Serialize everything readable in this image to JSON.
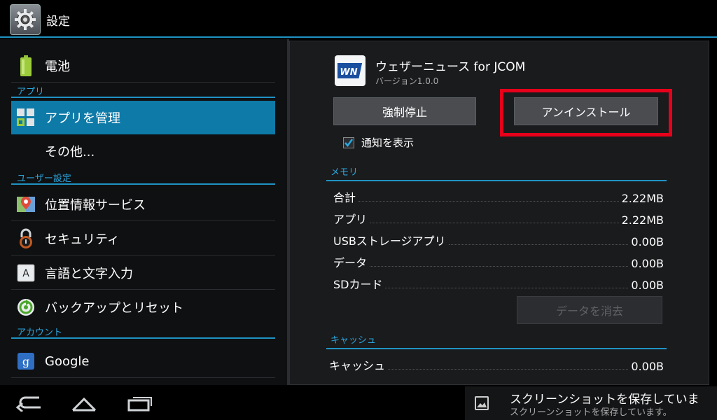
{
  "actionbar": {
    "title": "設定",
    "icon": "gear-icon"
  },
  "sidebar": {
    "items": [
      {
        "label": "電池",
        "icon": "battery-icon"
      },
      {
        "label": "アプリを管理",
        "icon": "apps-grid-icon",
        "selected": true
      },
      {
        "label": "その他...",
        "icon": ""
      },
      {
        "label": "位置情報サービス",
        "icon": "location-map-icon"
      },
      {
        "label": "セキュリティ",
        "icon": "lock-icon"
      },
      {
        "label": "言語と文字入力",
        "icon": "keyboard-a-icon"
      },
      {
        "label": "バックアップとリセット",
        "icon": "backup-reset-icon"
      },
      {
        "label": "Google",
        "icon": "google-icon"
      }
    ],
    "sections": [
      "アプリ",
      "ユーザー設定",
      "アカウント"
    ]
  },
  "detail": {
    "app_name": "ウェザーニュース for JCOM",
    "version": "バージョン1.0.0",
    "force_stop_label": "強制停止",
    "uninstall_label": "アンインストール",
    "notify_label": "通知を表示",
    "notify_checked": true,
    "memory_header": "メモリ",
    "memory_rows": [
      {
        "key": "合計",
        "value": "2.22MB"
      },
      {
        "key": "アプリ",
        "value": "2.22MB"
      },
      {
        "key": "USBストレージアプリ",
        "value": "0.00B"
      },
      {
        "key": "データ",
        "value": "0.00B"
      },
      {
        "key": "SDカード",
        "value": "0.00B"
      }
    ],
    "clear_data_label": "データを消去",
    "cache_header": "キャッシュ",
    "cache_rows": [
      {
        "key": "キャッシュ",
        "value": "0.00B"
      }
    ]
  },
  "toast": {
    "title": "スクリーンショットを保存していま",
    "subtitle": "スクリーンショットを保存しています。"
  },
  "colors": {
    "accent": "#1f93c4",
    "selected": "#0e7aa8",
    "highlight": "#e6001a"
  }
}
